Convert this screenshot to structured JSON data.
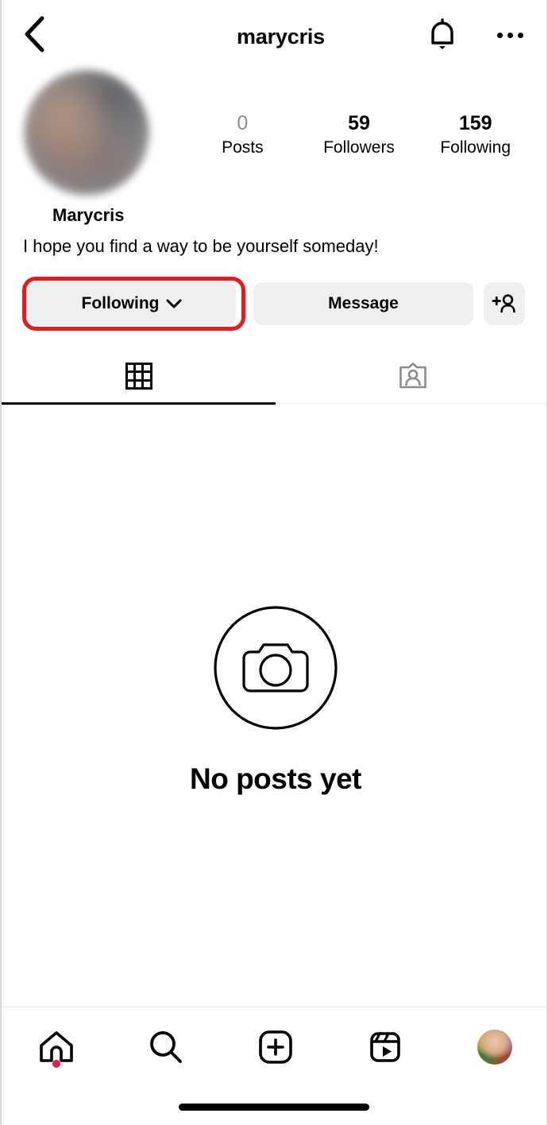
{
  "header": {
    "back_icon": "chevron-left-icon",
    "title": "marycris",
    "bell_icon": "bell-icon",
    "menu_icon": "ellipsis-icon"
  },
  "profile": {
    "avatar_alt": "blurred-profile-photo",
    "display_name": "Marycris",
    "bio": "I hope you find a way to be yourself someday!",
    "stats": [
      {
        "value": "0",
        "label": "Posts",
        "muted": true
      },
      {
        "value": "59",
        "label": "Followers",
        "muted": false
      },
      {
        "value": "159",
        "label": "Following",
        "muted": false
      }
    ]
  },
  "actions": {
    "following_label": "Following",
    "following_chevron": "chevron-down-icon",
    "message_label": "Message",
    "adduser_icon": "add-person-icon",
    "highlight_color": "#e8191b"
  },
  "tabs": [
    {
      "name": "grid",
      "icon": "grid-icon",
      "active": true
    },
    {
      "name": "tagged",
      "icon": "tagged-person-icon",
      "active": false
    }
  ],
  "empty_state": {
    "icon": "camera-circle-icon",
    "title": "No posts yet"
  },
  "bottom_nav": [
    {
      "name": "home",
      "icon": "home-icon",
      "badge": true
    },
    {
      "name": "search",
      "icon": "search-icon",
      "badge": false
    },
    {
      "name": "create",
      "icon": "plus-square-icon",
      "badge": false
    },
    {
      "name": "reels",
      "icon": "reels-icon",
      "badge": false
    },
    {
      "name": "profile",
      "icon": "avatar-icon",
      "badge": false
    }
  ]
}
